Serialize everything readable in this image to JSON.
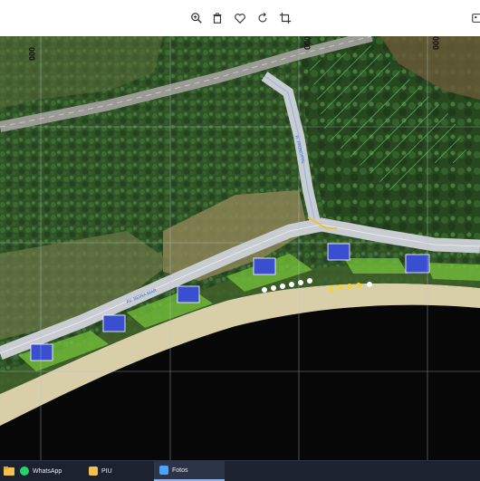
{
  "toolbar": {
    "icons": [
      "zoom-in-icon",
      "delete-icon",
      "favorite-heart-icon",
      "rotate-icon",
      "crop-icon",
      "edit-icon"
    ]
  },
  "map": {
    "labels": {
      "road_main": "AV. BEIRA MAR",
      "road_branch": "R. PRINCIPAL"
    },
    "corner_marks": [
      "000",
      "000",
      "000"
    ],
    "colors": {
      "ocean": "#070707",
      "forest": "#2a4a22",
      "road": "#c9ccd1",
      "beach": "#d8cfa8",
      "kiosk": "#3a4fd0",
      "grid": "#b8c4d6",
      "overlay_green": "#35d14a"
    }
  },
  "taskbar": {
    "items": [
      {
        "label": "WhatsApp",
        "icon": "whatsapp-icon",
        "color": "#25d366"
      },
      {
        "label": "PIU",
        "icon": "folder-icon",
        "color": "#f2c14e"
      },
      {
        "label": "Fotos",
        "icon": "photos-icon",
        "color": "#4aa3ff"
      }
    ]
  }
}
